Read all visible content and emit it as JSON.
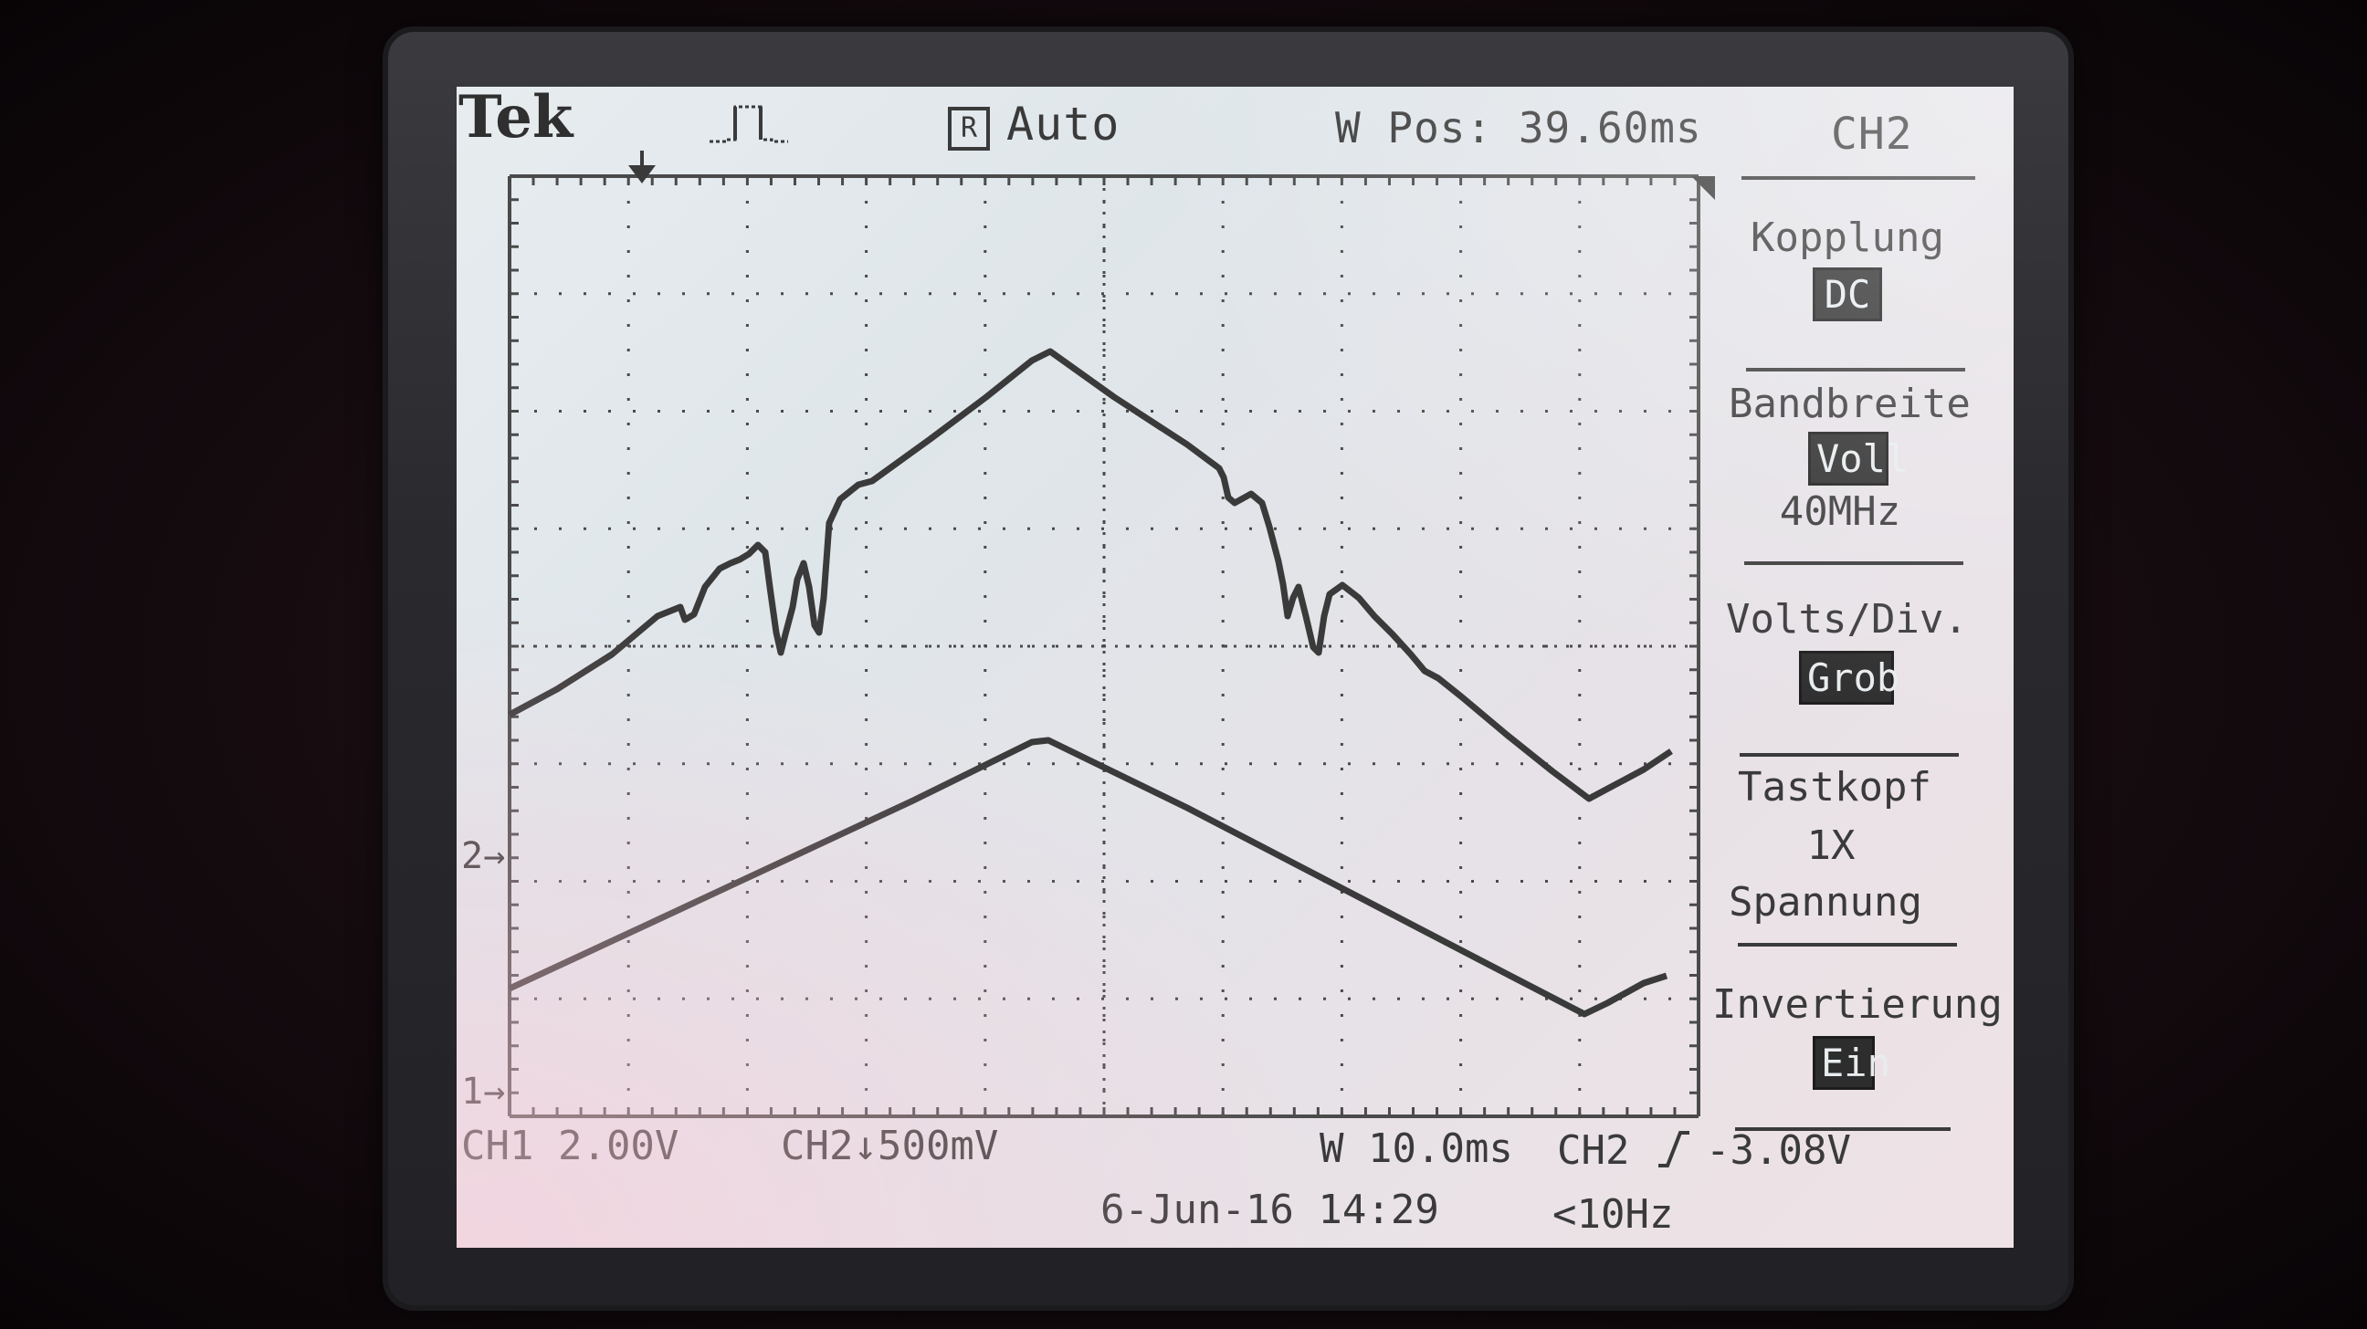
{
  "header": {
    "brand": "Tek",
    "run_badge": "R",
    "acquisition_state": "Auto",
    "horizontal_position": "W Pos: 39.60ms",
    "menu_channel": "CH2"
  },
  "side_menu": {
    "coupling": {
      "label": "Kopplung",
      "value": "DC"
    },
    "bandwidth": {
      "label": "Bandbreite",
      "value": "Voll",
      "limit": "40MHz"
    },
    "volts_div": {
      "label": "Volts/Div.",
      "value": "Grob"
    },
    "probe": {
      "label": "Tastkopf",
      "factor": "1X",
      "type": "Spannung"
    },
    "invert": {
      "label": "Invertierung",
      "value": "Ein"
    }
  },
  "markers": {
    "ch2_ground": "2",
    "ch1_ground": "1"
  },
  "status_bar": {
    "ch1_scale": "CH1  2.00V",
    "ch2_scale": "CH2↓500mV",
    "timebase": "W 10.0ms",
    "trigger_source": "CH2",
    "trigger_level": "-3.08V",
    "date_time": "6-Jun-16 14:29",
    "frequency": "<10Hz"
  },
  "colors": {
    "screen_bg": "#e3e8eb",
    "trace": "#3a3a3a",
    "bezel": "#2a2a2e"
  },
  "icons": {
    "trigger_type": "pulse-trigger-icon",
    "trigger_position": "trigger-position-arrow-icon",
    "trigger_slope": "rising-edge-icon"
  }
}
